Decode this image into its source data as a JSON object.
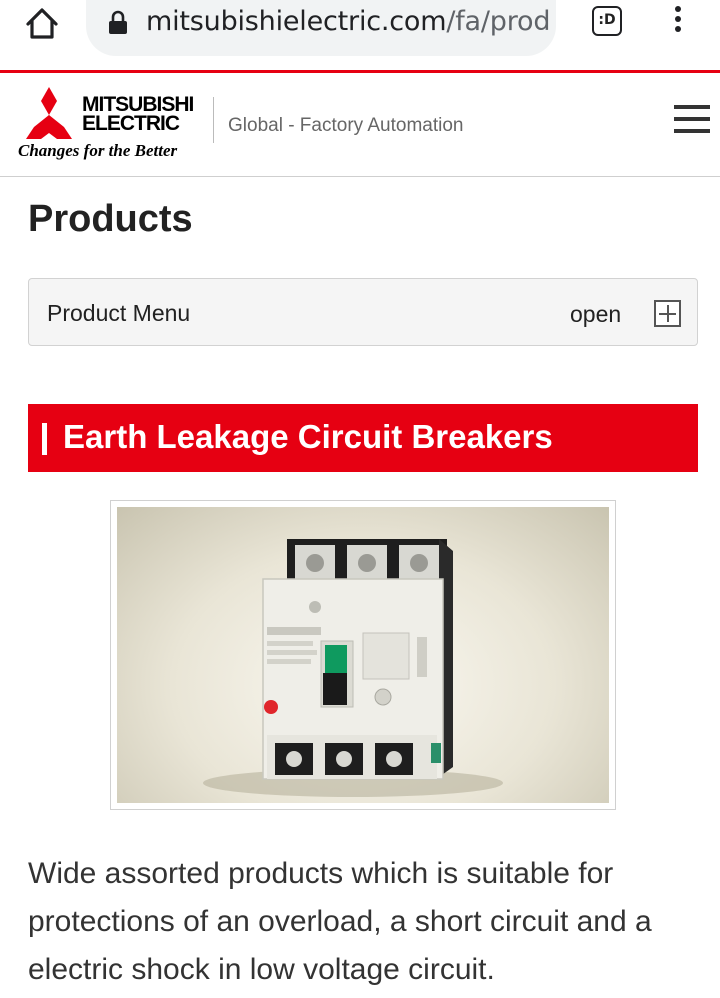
{
  "browser": {
    "url_domain": "mitsubishielectric.com",
    "url_path": "/fa/prod",
    "tabs_icon_label": ":D",
    "icons": [
      "home-icon",
      "lock-icon",
      "tab-switcher-icon",
      "more-vert-icon"
    ]
  },
  "header": {
    "logo_line1": "MITSUBISHI",
    "logo_line2": "ELECTRIC",
    "tagline": "Changes for the Better",
    "site_section": "Global - Factory Automation",
    "menu_icon": "hamburger-icon"
  },
  "page": {
    "title": "Products",
    "product_menu": {
      "label": "Product Menu",
      "toggle_label": "open",
      "icon": "plus-icon"
    },
    "section_title": "Earth Leakage Circuit Breakers",
    "description": "Wide assorted products which is suitable for protections of an overload, a short circuit and a electric shock in low voltage circuit."
  },
  "colors": {
    "brand_red": "#e60012",
    "menu_bg": "#f5f5f5",
    "text": "#333333"
  }
}
